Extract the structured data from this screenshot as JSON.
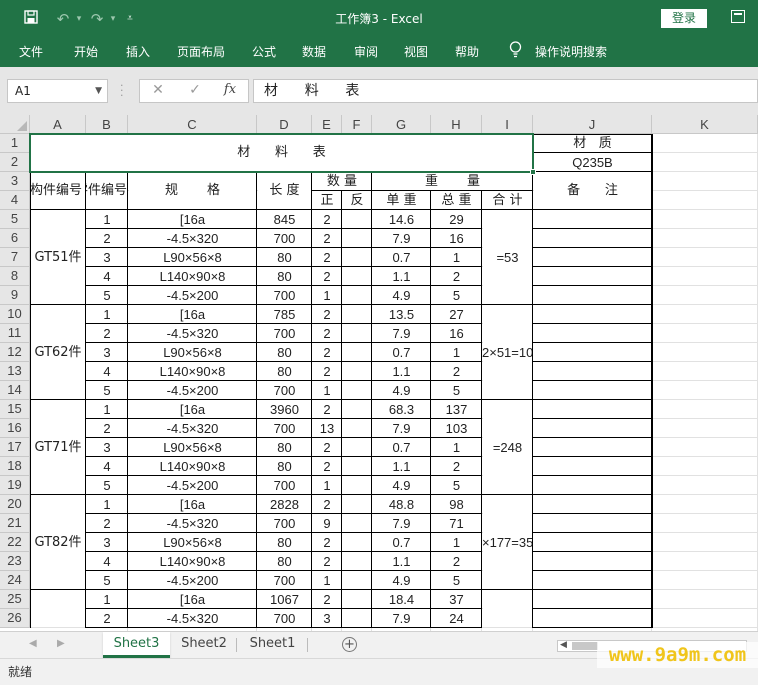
{
  "window": {
    "title": "工作簿3  -  Excel",
    "login_label": "登录"
  },
  "quick_access": {
    "save_icon": "save-icon",
    "undo_icon": "undo-icon",
    "redo_icon": "redo-icon",
    "customize_icon": "customize-qat-icon"
  },
  "ribbon": {
    "tabs": [
      "文件",
      "开始",
      "插入",
      "页面布局",
      "公式",
      "数据",
      "审阅",
      "视图",
      "帮助"
    ],
    "tell_me": "操作说明搜索"
  },
  "formula_bar": {
    "name_box": "A1",
    "formula": "材      料      表"
  },
  "columns": [
    "A",
    "B",
    "C",
    "D",
    "E",
    "F",
    "G",
    "H",
    "I",
    "J",
    "K"
  ],
  "rows": [
    "1",
    "2",
    "3",
    "4",
    "5",
    "6",
    "7",
    "8",
    "9",
    "10",
    "11",
    "12",
    "13",
    "14",
    "15",
    "16",
    "17",
    "18",
    "19",
    "20",
    "21",
    "22",
    "23",
    "24",
    "25",
    "26"
  ],
  "sheet": {
    "title": "材      料      表",
    "material_label": "材   质",
    "material_value": "Q235B",
    "headers": {
      "component_no": "构件编号",
      "part_no": "零件编号",
      "spec": "规       格",
      "length": "长 度",
      "quantity": "数 量",
      "weight": "重       量",
      "remarks": "备      注",
      "front": "正",
      "back": "反",
      "unit_weight": "单 重",
      "total_weight": "总 重",
      "sum": "合 计"
    },
    "groups": [
      {
        "name": "GT51件",
        "sum": "=53",
        "items": [
          {
            "no": "1",
            "spec": "[16a",
            "len": "845",
            "qty": "2",
            "rev": "",
            "unit": "14.6",
            "total": "29"
          },
          {
            "no": "2",
            "spec": "-4.5×320",
            "len": "700",
            "qty": "2",
            "rev": "",
            "unit": "7.9",
            "total": "16"
          },
          {
            "no": "3",
            "spec": "L90×56×8",
            "len": "80",
            "qty": "2",
            "rev": "",
            "unit": "0.7",
            "total": "1"
          },
          {
            "no": "4",
            "spec": "L140×90×8",
            "len": "80",
            "qty": "2",
            "rev": "",
            "unit": "1.1",
            "total": "2"
          },
          {
            "no": "5",
            "spec": "-4.5×200",
            "len": "700",
            "qty": "1",
            "rev": "",
            "unit": "4.9",
            "total": "5"
          }
        ]
      },
      {
        "name": "GT62件",
        "sum": "2×51=10",
        "items": [
          {
            "no": "1",
            "spec": "[16a",
            "len": "785",
            "qty": "2",
            "rev": "",
            "unit": "13.5",
            "total": "27"
          },
          {
            "no": "2",
            "spec": "-4.5×320",
            "len": "700",
            "qty": "2",
            "rev": "",
            "unit": "7.9",
            "total": "16"
          },
          {
            "no": "3",
            "spec": "L90×56×8",
            "len": "80",
            "qty": "2",
            "rev": "",
            "unit": "0.7",
            "total": "1"
          },
          {
            "no": "4",
            "spec": "L140×90×8",
            "len": "80",
            "qty": "2",
            "rev": "",
            "unit": "1.1",
            "total": "2"
          },
          {
            "no": "5",
            "spec": "-4.5×200",
            "len": "700",
            "qty": "1",
            "rev": "",
            "unit": "4.9",
            "total": "5"
          }
        ]
      },
      {
        "name": "GT71件",
        "sum": "=248",
        "items": [
          {
            "no": "1",
            "spec": "[16a",
            "len": "3960",
            "qty": "2",
            "rev": "",
            "unit": "68.3",
            "total": "137"
          },
          {
            "no": "2",
            "spec": "-4.5×320",
            "len": "700",
            "qty": "13",
            "rev": "",
            "unit": "7.9",
            "total": "103"
          },
          {
            "no": "3",
            "spec": "L90×56×8",
            "len": "80",
            "qty": "2",
            "rev": "",
            "unit": "0.7",
            "total": "1"
          },
          {
            "no": "4",
            "spec": "L140×90×8",
            "len": "80",
            "qty": "2",
            "rev": "",
            "unit": "1.1",
            "total": "2"
          },
          {
            "no": "5",
            "spec": "-4.5×200",
            "len": "700",
            "qty": "1",
            "rev": "",
            "unit": "4.9",
            "total": "5"
          }
        ]
      },
      {
        "name": "GT82件",
        "sum": "×177=35",
        "items": [
          {
            "no": "1",
            "spec": "[16a",
            "len": "2828",
            "qty": "2",
            "rev": "",
            "unit": "48.8",
            "total": "98"
          },
          {
            "no": "2",
            "spec": "-4.5×320",
            "len": "700",
            "qty": "9",
            "rev": "",
            "unit": "7.9",
            "total": "71"
          },
          {
            "no": "3",
            "spec": "L90×56×8",
            "len": "80",
            "qty": "2",
            "rev": "",
            "unit": "0.7",
            "total": "1"
          },
          {
            "no": "4",
            "spec": "L140×90×8",
            "len": "80",
            "qty": "2",
            "rev": "",
            "unit": "1.1",
            "total": "2"
          },
          {
            "no": "5",
            "spec": "-4.5×200",
            "len": "700",
            "qty": "1",
            "rev": "",
            "unit": "4.9",
            "total": "5"
          }
        ]
      },
      {
        "name": "",
        "sum": "",
        "items": [
          {
            "no": "1",
            "spec": "[16a",
            "len": "1067",
            "qty": "2",
            "rev": "",
            "unit": "18.4",
            "total": "37"
          },
          {
            "no": "2",
            "spec": "-4.5×320",
            "len": "700",
            "qty": "3",
            "rev": "",
            "unit": "7.9",
            "total": "24"
          }
        ]
      }
    ]
  },
  "sheet_tabs": [
    "Sheet3",
    "Sheet2",
    "Sheet1"
  ],
  "active_sheet": "Sheet3",
  "status": "就绪",
  "watermark": "www.9a9m.com",
  "colors": {
    "accent": "#217346",
    "grid": "#e1e1e1",
    "header_bg": "#e6e6e6",
    "watermark": "#f0c51b"
  }
}
